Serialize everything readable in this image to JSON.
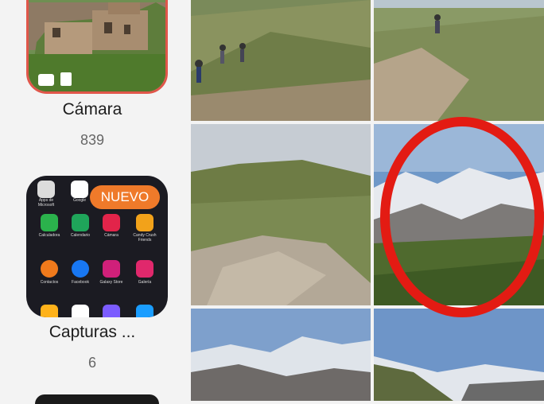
{
  "albums": [
    {
      "name": "Cámara",
      "count": "839"
    },
    {
      "name": "Capturas ...",
      "count": "6"
    }
  ],
  "screenshot_album": {
    "badge": "NUEVO",
    "apps": [
      {
        "label": "Calculadora",
        "color": "#2bb24c"
      },
      {
        "label": "Calendario",
        "color": "#1fa55a"
      },
      {
        "label": "Cámara",
        "color": "#e2244a"
      },
      {
        "label": "Candy Crush Friends",
        "color": "#f2a21a"
      },
      {
        "label": "Contactos",
        "color": "#f07a1c"
      },
      {
        "label": "Facebook",
        "color": "#1877f2"
      },
      {
        "label": "Galaxy Store",
        "color": "#d0207a"
      },
      {
        "label": "Galería",
        "color": "#e0286c"
      }
    ],
    "top_labels": [
      "Apps de Microsoft",
      "Google"
    ]
  },
  "annotation": {
    "shape": "circle",
    "color": "#e31b13"
  }
}
